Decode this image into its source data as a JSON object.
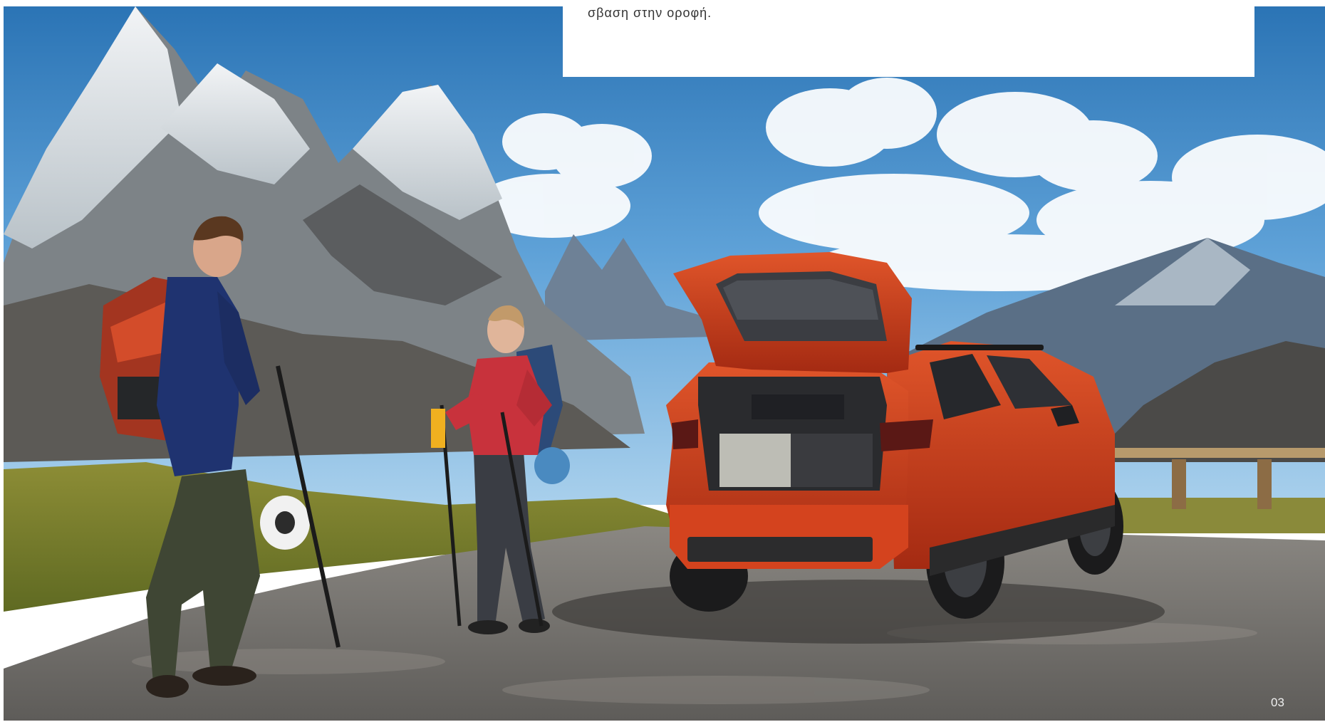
{
  "text_box": {
    "line": "σβαση στην οροφή."
  },
  "page_number": "03",
  "photo": {
    "icon": "mountain-photo-icon",
    "colors": {
      "sky_top": "#2b74b5",
      "sky_bottom": "#8dc3e8",
      "car_body": "#d8421f",
      "jacket_red": "#c8323c",
      "jacket_blue": "#1f3370",
      "grass": "#7a8a2a",
      "gravel": "#7c7a76"
    }
  }
}
